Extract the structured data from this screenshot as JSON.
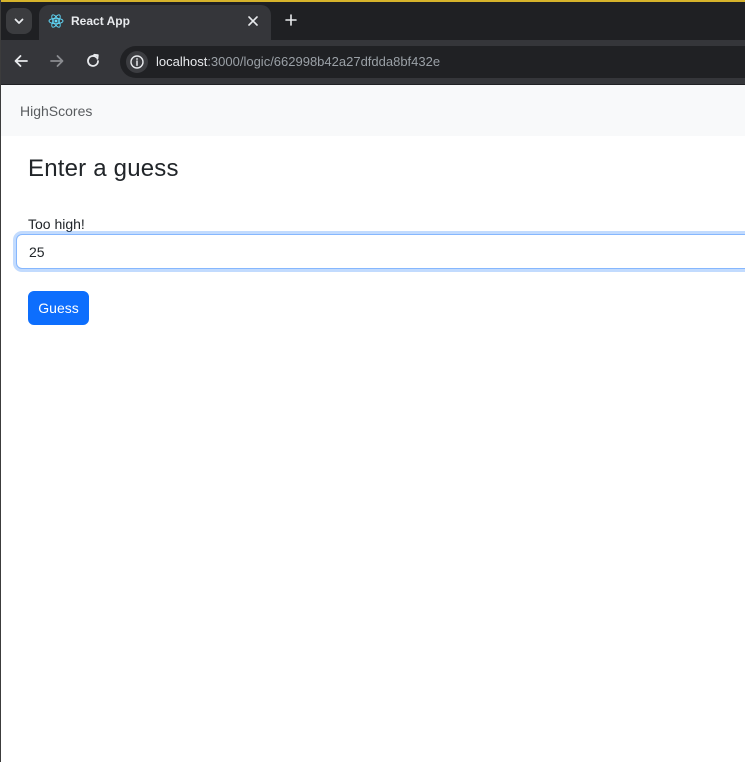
{
  "browser": {
    "tab": {
      "title": "React App",
      "favicon": "react-logo-icon"
    },
    "url": {
      "host": "localhost",
      "path": ":3000/logic/662998b42a27dfdda8bf432e"
    },
    "icons": {
      "tab_search": "chevron-down-icon",
      "tab_close": "close-icon",
      "new_tab": "plus-icon",
      "back": "arrow-left-icon",
      "forward": "arrow-right-icon",
      "reload": "reload-icon",
      "site_info": "info-icon"
    },
    "colors": {
      "accent_strip": "#d6b32b",
      "tabstrip_bg": "#1f2023",
      "toolbar_bg": "#35363a"
    }
  },
  "page": {
    "navbar": {
      "brand_link": "HighScores"
    },
    "title": "Enter a guess",
    "feedback": "Too high!",
    "guess_input": {
      "value": "25"
    },
    "guess_button": "Guess",
    "colors": {
      "primary": "#0d6efd",
      "navbar_bg": "#f8f9fa",
      "text": "#212529"
    }
  }
}
